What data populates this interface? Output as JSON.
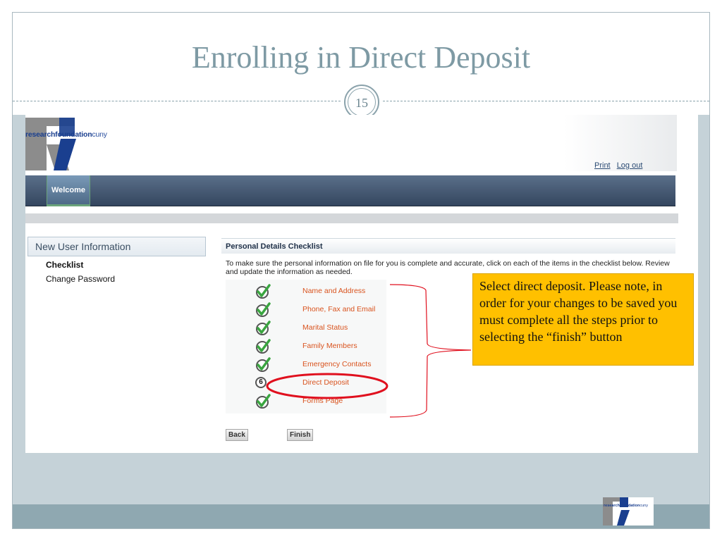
{
  "slide": {
    "title": "Enrolling in Direct Deposit",
    "page_number": "15"
  },
  "app": {
    "logo_text_bold": "researchfoundation",
    "logo_text_light": "cuny",
    "header_links": {
      "print": "Print",
      "logout": "Log out"
    },
    "nav": {
      "welcome": "Welcome"
    },
    "sidebar": {
      "header": "New User Information",
      "items": [
        {
          "label": "Checklist",
          "active": true
        },
        {
          "label": "Change Password",
          "active": false
        }
      ]
    },
    "main": {
      "title": "Personal Details Checklist",
      "description": "To make sure the personal information on file for you is complete and accurate, click on each of the items in the checklist below. Review and update the information as needed.",
      "checklist": [
        {
          "label": "Name and Address",
          "status": "done"
        },
        {
          "label": "Phone, Fax and Email",
          "status": "done"
        },
        {
          "label": "Marital Status",
          "status": "done"
        },
        {
          "label": "Family Members",
          "status": "done"
        },
        {
          "label": "Emergency Contacts",
          "status": "done"
        },
        {
          "label": "Direct Deposit",
          "status": "pending",
          "step": "6"
        },
        {
          "label": "Forms Page",
          "status": "done"
        }
      ],
      "buttons": {
        "back": "Back",
        "finish": "Finish"
      }
    }
  },
  "callout": {
    "text": "Select direct deposit. Please note, in order for your changes to be saved you must complete all the steps prior to selecting the “finish” button"
  },
  "colors": {
    "accent_title": "#7e9aa4",
    "link_orange": "#d9531e",
    "callout_bg": "#ffc000",
    "highlight_red": "#e0101e",
    "check_green": "#3aa540"
  },
  "footer_logo": {
    "text_bold": "researchfoundation",
    "text_light": "cuny"
  }
}
